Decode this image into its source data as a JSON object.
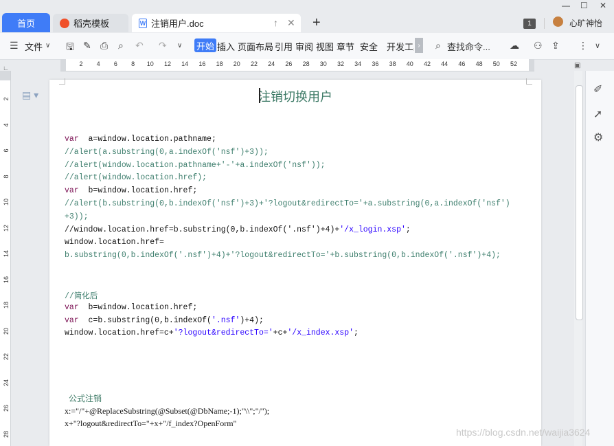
{
  "tabs": {
    "home": "首页",
    "docer": "稻壳模板",
    "document": "注销用户.doc"
  },
  "user": {
    "name": "心旷神怡",
    "badge": "1"
  },
  "toolbar": {
    "file_menu": "文件",
    "start": "开始",
    "items": [
      "插入",
      "页面布局",
      "引用",
      "审阅",
      "视图",
      "章节",
      "安全",
      "开发工具"
    ],
    "search_placeholder": "查找命令..."
  },
  "ruler": {
    "h_ticks": [
      "2",
      "4",
      "6",
      "8",
      "10",
      "12",
      "14",
      "16",
      "18",
      "20",
      "22",
      "24",
      "26",
      "28",
      "30",
      "32",
      "34",
      "36",
      "38",
      "40",
      "42",
      "44",
      "46",
      "48",
      "50",
      "52"
    ],
    "v_ticks": [
      "2",
      "4",
      "6",
      "8",
      "10",
      "12",
      "14",
      "16",
      "18",
      "20",
      "22",
      "24",
      "26",
      "28"
    ]
  },
  "document": {
    "title": "注销切换用户",
    "code_block_1": [
      [
        [
          "kw",
          "var"
        ],
        [
          "",
          "  a=window.location.pathname;"
        ]
      ],
      [
        [
          "cm",
          "//alert(a.substring(0,a.indexOf('nsf')+3));"
        ]
      ],
      [
        [
          "cm",
          "//alert(window.location.pathname+'-'+a.indexOf('nsf'));"
        ]
      ],
      [
        [
          "cm",
          "//alert(window.location.href);"
        ]
      ],
      [
        [
          "kw",
          "var"
        ],
        [
          "",
          "  b=window.location.href;"
        ]
      ],
      [
        [
          "cm",
          "//alert(b.substring(0,b.indexOf('nsf')+3)+'?logout&redirectTo='+a.substring(0,a.indexOf('nsf')"
        ]
      ],
      [
        [
          "cm",
          "+3));"
        ]
      ],
      [
        [
          "",
          "//window.location.href=b.substring(0,b.indexOf('.nsf')+4)+"
        ],
        [
          "st",
          "'/x_login.xsp'"
        ],
        [
          "",
          ";"
        ]
      ],
      [
        [
          "",
          "window.location.href="
        ]
      ],
      [
        [
          "cm",
          "b.substring(0,b.indexOf('.nsf')+4)+'?logout&redirectTo='+b.substring(0,b.indexOf('.nsf')+4);"
        ]
      ]
    ],
    "code_block_2": [
      [
        [
          "cm",
          "//简化后"
        ]
      ],
      [
        [
          "kw",
          "var"
        ],
        [
          "",
          "  b=window.location.href;"
        ]
      ],
      [
        [
          "kw",
          "var"
        ],
        [
          "",
          "  c=b.substring(0,b.indexOf("
        ],
        [
          "st",
          "'.nsf'"
        ],
        [
          "",
          ")+4);"
        ]
      ],
      [
        [
          "",
          "window.location.href=c+"
        ],
        [
          "st",
          "'?logout&redirectTo='"
        ],
        [
          "",
          "+c+"
        ],
        [
          "st",
          "'/x_index.xsp'"
        ],
        [
          "",
          ";"
        ]
      ]
    ],
    "formula_heading": "公式注销",
    "formula_line_1": "x:=\"/\"+@ReplaceSubstring(@Subset(@DbName;-1);\"\\\\\";\"/\");",
    "formula_line_2": "x+\"?logout&redirectTo=\"+x+\"/f_index?OpenForm\""
  },
  "watermark": "https://blog.csdn.net/waijia3624"
}
